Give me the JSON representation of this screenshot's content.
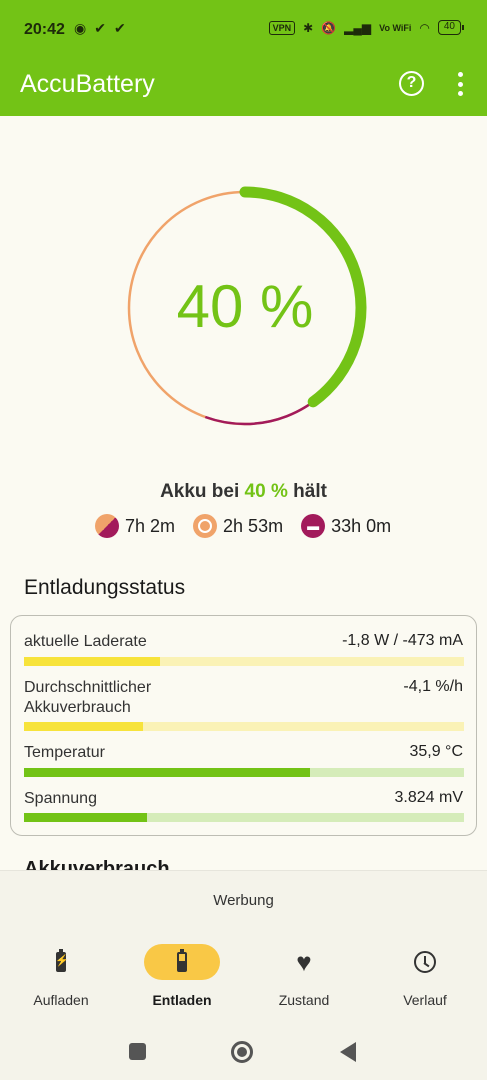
{
  "status_bar": {
    "time": "20:42",
    "left_icons": [
      "wechat-icon",
      "check-icon",
      "check-icon"
    ],
    "vpn_label": "VPN",
    "vowifi_label": "Vo WiFi",
    "battery_level": "40"
  },
  "app_bar": {
    "title": "AccuBattery",
    "help_icon": "help-circle-icon",
    "more_icon": "more-vert-icon"
  },
  "gauge": {
    "percent_text": "40 %",
    "level_fraction": 0.4,
    "colors": {
      "active": "#73c316",
      "screen_on": "#f0a36a",
      "screen_off": "#a21a5b"
    }
  },
  "holds": {
    "prefix": "Akku bei",
    "percent": "40 %",
    "suffix": "hält"
  },
  "estimates": [
    {
      "icon": "mixed-usage-icon",
      "value": "7h 2m"
    },
    {
      "icon": "screen-on-icon",
      "value": "2h 53m"
    },
    {
      "icon": "sleep-icon",
      "value": "33h 0m"
    }
  ],
  "section_title": "Entladungsstatus",
  "stats": [
    {
      "label": "aktuelle Laderate",
      "value": "-1,8 W / -473 mA",
      "fill_fraction": 0.31,
      "color": "yellow"
    },
    {
      "label": "Durchschnittlicher Akkuverbrauch",
      "value": "-4,1 %/h",
      "fill_fraction": 0.27,
      "color": "yellow"
    },
    {
      "label": "Temperatur",
      "value": "35,9 °C",
      "fill_fraction": 0.65,
      "color": "green"
    },
    {
      "label": "Spannung",
      "value": "3.824 mV",
      "fill_fraction": 0.28,
      "color": "green"
    }
  ],
  "next_section_title": "Akkuverbrauch",
  "ad_label": "Werbung",
  "bottom_nav": [
    {
      "label": "Aufladen",
      "icon": "battery-charging-icon",
      "active": false
    },
    {
      "label": "Entladen",
      "icon": "battery-discharge-icon",
      "active": true
    },
    {
      "label": "Zustand",
      "icon": "heart-icon",
      "active": false
    },
    {
      "label": "Verlauf",
      "icon": "history-icon",
      "active": false
    }
  ]
}
